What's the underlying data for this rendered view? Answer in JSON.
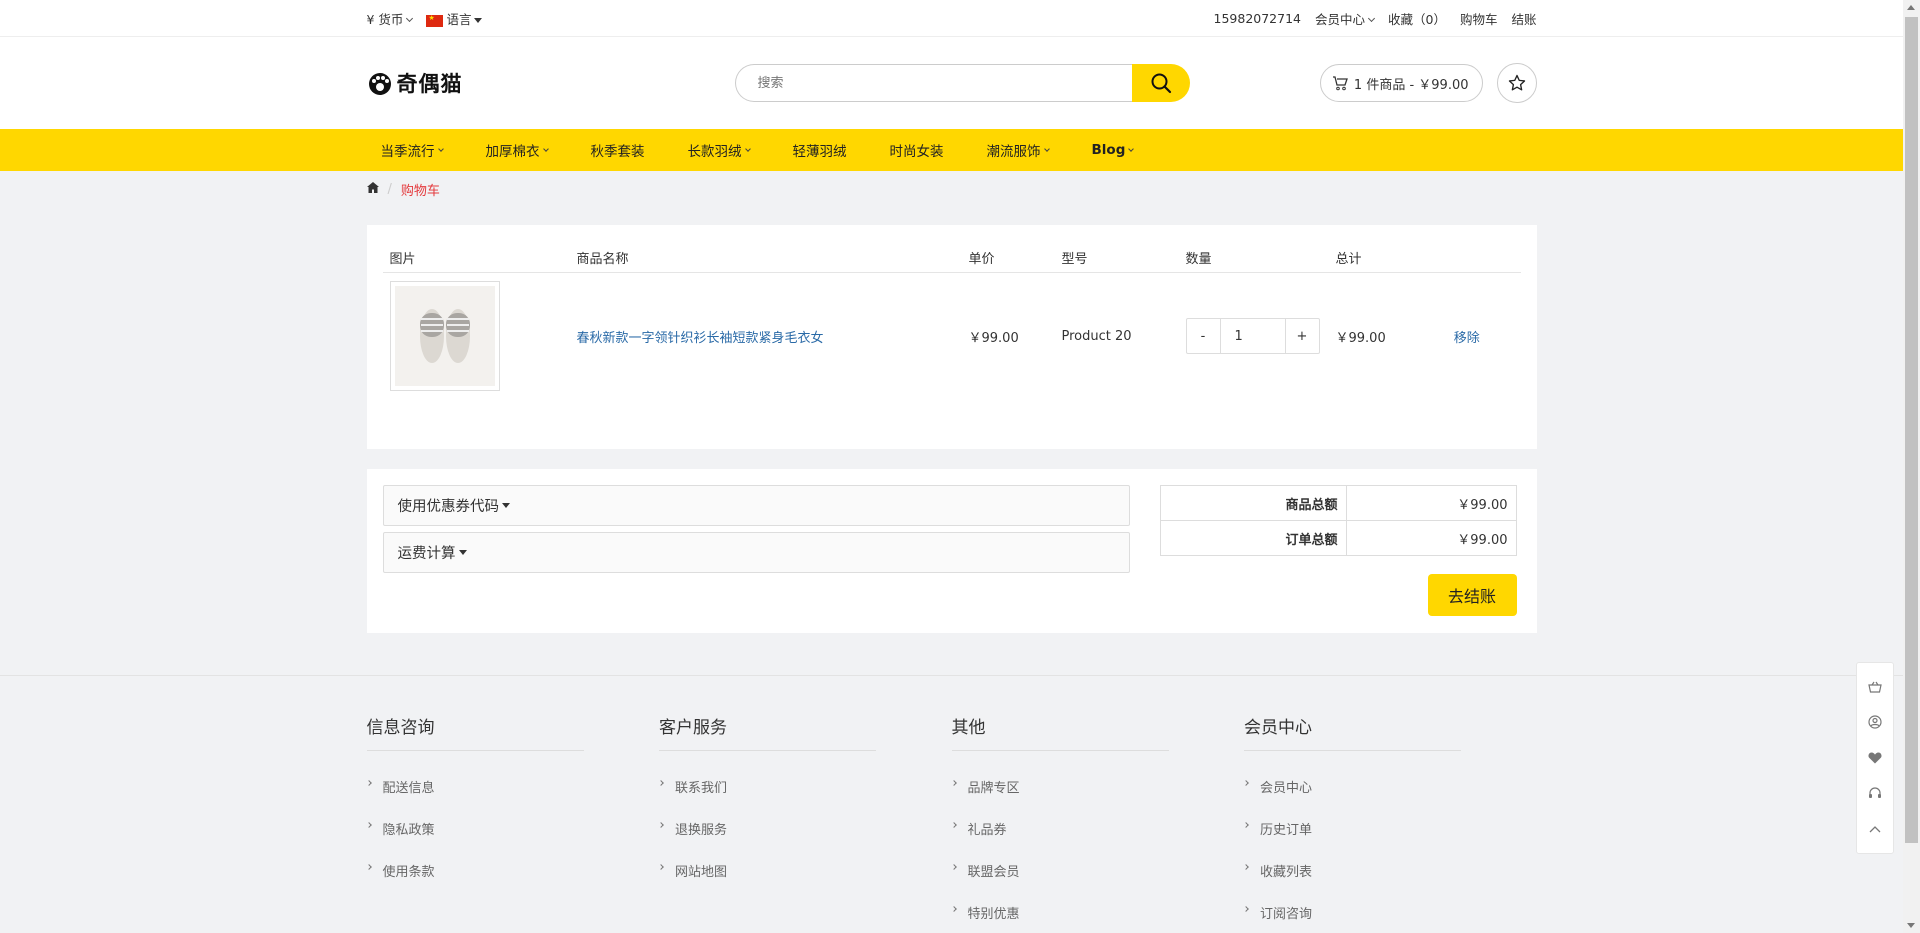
{
  "topbar": {
    "currency_label": "¥ 货币",
    "language_label": "语言",
    "phone": "15982072714",
    "member_center": "会员中心",
    "favorites": "收藏（0）",
    "cart": "购物车",
    "checkout": "结账"
  },
  "header": {
    "logo_text": "奇偶猫",
    "search_placeholder": "搜索",
    "cart_summary": "1 件商品 - ￥99.00"
  },
  "nav": {
    "items": [
      {
        "label": "当季流行",
        "dropdown": true
      },
      {
        "label": "加厚棉衣",
        "dropdown": true
      },
      {
        "label": "秋季套装",
        "dropdown": false
      },
      {
        "label": "长款羽绒",
        "dropdown": true
      },
      {
        "label": "轻薄羽绒",
        "dropdown": false
      },
      {
        "label": "时尚女装",
        "dropdown": false
      },
      {
        "label": "潮流服饰",
        "dropdown": true
      },
      {
        "label": "Blog",
        "dropdown": true
      }
    ]
  },
  "breadcrumb": {
    "current": "购物车"
  },
  "cart_table": {
    "headers": [
      "图片",
      "商品名称",
      "单价",
      "型号",
      "数量",
      "总计"
    ],
    "rows": [
      {
        "name": "春秋新款一字领针织衫长袖短款紧身毛衣女",
        "unit_price": "￥99.00",
        "model": "Product 20",
        "qty_minus": "-",
        "quantity": "1",
        "qty_plus": "+",
        "total": "￥99.00",
        "remove": "移除"
      }
    ]
  },
  "options": {
    "coupon": "使用优惠券代码",
    "shipping": "运费计算"
  },
  "totals": {
    "subtotal_label": "商品总额",
    "subtotal_value": "￥99.00",
    "total_label": "订单总额",
    "total_value": "￥99.00",
    "checkout_button": "去结账"
  },
  "footer": {
    "columns": [
      {
        "title": "信息咨询",
        "links": [
          "配送信息",
          "隐私政策",
          "使用条款"
        ]
      },
      {
        "title": "客户服务",
        "links": [
          "联系我们",
          "退换服务",
          "网站地图"
        ]
      },
      {
        "title": "其他",
        "links": [
          "品牌专区",
          "礼品券",
          "联盟会员",
          "特别优惠"
        ]
      },
      {
        "title": "会员中心",
        "links": [
          "会员中心",
          "历史订单",
          "收藏列表",
          "订阅咨询"
        ]
      }
    ]
  },
  "colors": {
    "accent": "#ffd700",
    "link": "#2a6aa7",
    "breadcrumb_active": "#e4393c"
  },
  "icons": {
    "side_float": [
      "basket-icon",
      "user-icon",
      "heart-icon",
      "headset-icon",
      "chevron-up-icon"
    ]
  }
}
